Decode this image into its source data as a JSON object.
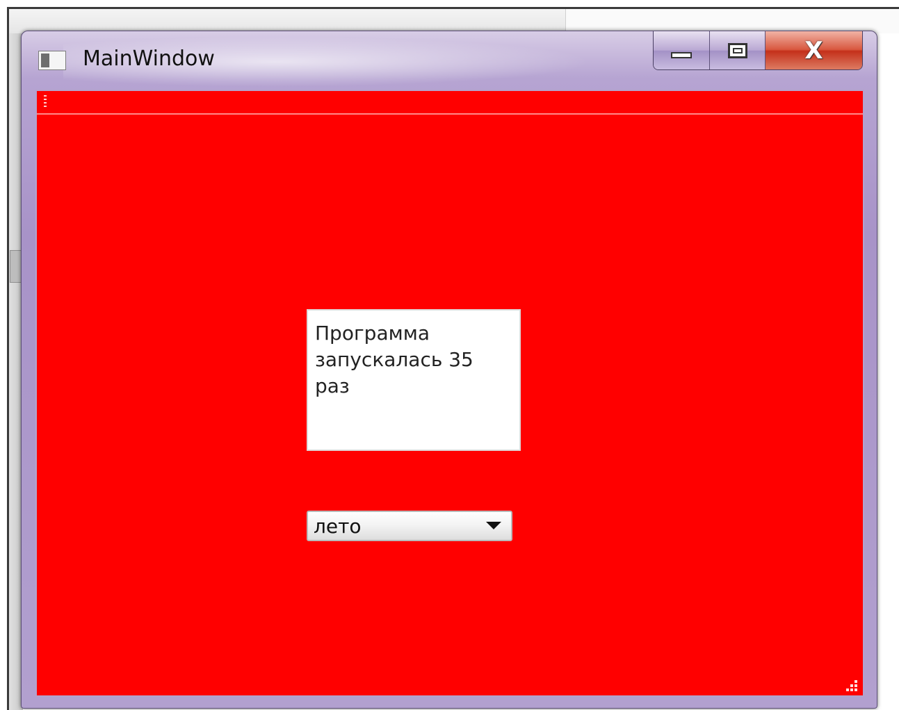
{
  "window": {
    "title": "MainWindow"
  },
  "main": {
    "textbox_text": "Программа запускалась 35 раз",
    "combo": {
      "selected": "лето"
    }
  },
  "colors": {
    "client_background": "#ff0000",
    "window_frame": "#a893c8",
    "close_button": "#c4301a"
  },
  "icons": {
    "app": "app-icon",
    "minimize": "minimize-icon",
    "maximize": "maximize-icon",
    "close": "close-icon",
    "combo_arrow": "chevron-down-icon",
    "resize": "resize-grip-icon"
  }
}
